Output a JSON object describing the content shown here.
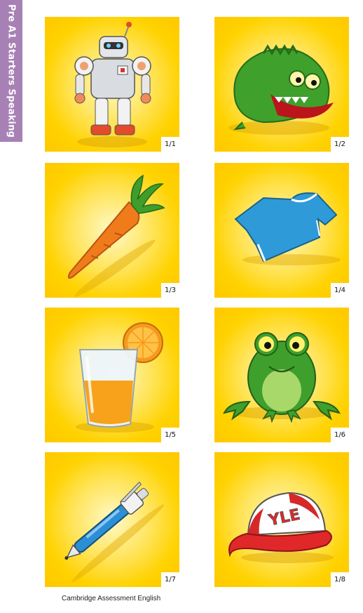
{
  "side_tab": {
    "label": "Pre A1 Starters Speaking"
  },
  "cards": [
    {
      "number": "1/1",
      "item": "robot",
      "icon": "robot-icon"
    },
    {
      "number": "1/2",
      "item": "crocodile",
      "icon": "crocodile-icon"
    },
    {
      "number": "1/3",
      "item": "carrot",
      "icon": "carrot-icon"
    },
    {
      "number": "1/4",
      "item": "t-shirt",
      "icon": "tshirt-icon"
    },
    {
      "number": "1/5",
      "item": "orange juice",
      "icon": "juice-icon"
    },
    {
      "number": "1/6",
      "item": "frog",
      "icon": "frog-icon"
    },
    {
      "number": "1/7",
      "item": "pen",
      "icon": "pen-icon"
    },
    {
      "number": "1/8",
      "item": "cap",
      "icon": "cap-icon",
      "logo_text": "YLE"
    }
  ],
  "footer": {
    "text": "Cambridge Assessment English"
  },
  "colors": {
    "tab": "#a781b5",
    "card_background": "#ffd200",
    "number_box": "#ffffff"
  }
}
